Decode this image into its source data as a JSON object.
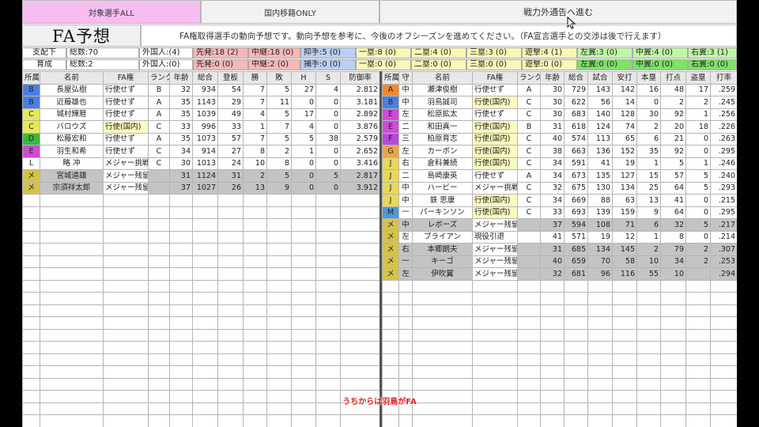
{
  "buttons": {
    "all": "対象選手ALL",
    "domestic": "国内移籍ONLY",
    "next": "戦力外通告へ進む"
  },
  "title": "FA予想",
  "description": "FA権取得選手の動向予想です。動向予想を参考に、今後のオフシーズンを進めてください。（FA宣言選手との交渉は後で行えます）",
  "summary": [
    [
      {
        "text": "支配下",
        "color": "#ffffff"
      },
      {
        "text": "総数:70",
        "color": "#ffffff"
      },
      {
        "text": "外国人:(4)",
        "color": "#ffffff"
      },
      {
        "text": "先発:18 (2)",
        "color": "#f6b8b8"
      },
      {
        "text": "中継:18 (0)",
        "color": "#f6b8b8"
      },
      {
        "text": "抑手:5 (0)",
        "color": "#b8d0f6"
      },
      {
        "text": "一塁:8 (0)",
        "color": "#fbf7b8"
      },
      {
        "text": "二塁:4 (0)",
        "color": "#fbf7b8"
      },
      {
        "text": "三塁:3 (0)",
        "color": "#fbf7b8"
      },
      {
        "text": "遊撃:4 (1)",
        "color": "#fbf7b8"
      },
      {
        "text": "左翼:3 (0)",
        "color": "#c2f5a8"
      },
      {
        "text": "中翼:4 (0)",
        "color": "#c2f5a8"
      },
      {
        "text": "右翼:3 (1)",
        "color": "#c2f5a8"
      }
    ],
    [
      {
        "text": "育成",
        "color": "#ffffff"
      },
      {
        "text": "総数:2",
        "color": "#ffffff"
      },
      {
        "text": "外国人:(0)",
        "color": "#ffffff"
      },
      {
        "text": "先発:0 (0)",
        "color": "#f6b8b8"
      },
      {
        "text": "中継:2 (0)",
        "color": "#f6b8b8"
      },
      {
        "text": "捕手:0 (0)",
        "color": "#b8d0f6"
      },
      {
        "text": "一塁:0 (0)",
        "color": "#fbf7b8"
      },
      {
        "text": "二塁:0 (0)",
        "color": "#fbf7b8"
      },
      {
        "text": "三塁:0 (0)",
        "color": "#fbf7b8"
      },
      {
        "text": "遊撃:0 (0)",
        "color": "#fbf7b8"
      },
      {
        "text": "左翼:0 (0)",
        "color": "#7fe06a"
      },
      {
        "text": "中翼:0 (0)",
        "color": "#7fe06a"
      },
      {
        "text": "右翼:0 (0)",
        "color": "#7fe06a"
      }
    ]
  ],
  "pitchers": {
    "headers": [
      "所属",
      "名前",
      "FA権",
      "ランク",
      "年齢",
      "総合",
      "登板",
      "勝",
      "敗",
      "H",
      "S",
      "防御率"
    ],
    "rows": [
      {
        "team": "B",
        "team_color": "#4a7fe0",
        "name": "長屋弘樹",
        "fa": "行使せず",
        "fa_type": "stay",
        "rank": "B",
        "age": "32",
        "ovr": "934",
        "g": "54",
        "w": "7",
        "l": "5",
        "h": "27",
        "s": "4",
        "era": "2.812",
        "gray": false
      },
      {
        "team": "B",
        "team_color": "#4a7fe0",
        "name": "近藤雄也",
        "fa": "行使せず",
        "fa_type": "stay",
        "rank": "A",
        "age": "35",
        "ovr": "1143",
        "g": "29",
        "w": "7",
        "l": "11",
        "h": "0",
        "s": "0",
        "era": "3.181",
        "gray": false
      },
      {
        "team": "C",
        "team_color": "#e8e85a",
        "name": "城村輝暦",
        "fa": "行使せず",
        "fa_type": "stay",
        "rank": "A",
        "age": "35",
        "ovr": "1039",
        "g": "49",
        "w": "4",
        "l": "5",
        "h": "17",
        "s": "0",
        "era": "2.892",
        "gray": false
      },
      {
        "team": "C",
        "team_color": "#e8e85a",
        "name": "バロウズ",
        "fa": "行使(国内)",
        "fa_type": "dom",
        "rank": "C",
        "age": "33",
        "ovr": "996",
        "g": "33",
        "w": "1",
        "l": "7",
        "h": "4",
        "s": "0",
        "era": "3.876",
        "gray": false
      },
      {
        "team": "D",
        "team_color": "#3cb83c",
        "name": "松藤宏和",
        "fa": "行使せず",
        "fa_type": "stay",
        "rank": "A",
        "age": "35",
        "ovr": "1073",
        "g": "57",
        "w": "7",
        "l": "5",
        "h": "5",
        "s": "38",
        "era": "2.579",
        "gray": false
      },
      {
        "team": "E",
        "team_color": "#d04ad8",
        "name": "羽生和希",
        "fa": "行使せず",
        "fa_type": "stay",
        "rank": "C",
        "age": "34",
        "ovr": "914",
        "g": "27",
        "w": "8",
        "l": "2",
        "h": "1",
        "s": "0",
        "era": "2.652",
        "gray": false
      },
      {
        "team": "L",
        "team_color": "#ffffff",
        "name": "略 冲",
        "fa": "メジャー挑戦",
        "fa_type": "mlb",
        "rank": "C",
        "age": "30",
        "ovr": "1013",
        "g": "24",
        "w": "10",
        "l": "8",
        "h": "0",
        "s": "0",
        "era": "3.416",
        "gray": false
      },
      {
        "team": "メ",
        "team_color": "#d6c24a",
        "name": "宮城道雄",
        "fa": "メジャー残留",
        "fa_type": "stay",
        "rank": "",
        "age": "31",
        "ovr": "1124",
        "g": "31",
        "w": "2",
        "l": "5",
        "h": "0",
        "s": "5",
        "era": "2.817",
        "gray": true
      },
      {
        "team": "メ",
        "team_color": "#d6c24a",
        "name": "宗須祥太郎",
        "fa": "メジャー残留",
        "fa_type": "stay",
        "rank": "",
        "age": "37",
        "ovr": "1027",
        "g": "26",
        "w": "13",
        "l": "9",
        "h": "0",
        "s": "0",
        "era": "3.912",
        "gray": true
      }
    ]
  },
  "batters": {
    "headers": [
      "所属",
      "守",
      "名前",
      "FA権",
      "ランク",
      "年齢",
      "総合",
      "試合",
      "安打",
      "本塁",
      "打点",
      "盗塁",
      "打率"
    ],
    "rows": [
      {
        "team": "A",
        "team_color": "#f08a2a",
        "pos": "中",
        "name": "瀬津俊樹",
        "fa": "行使せず",
        "fa_type": "stay",
        "rank": "A",
        "age": "30",
        "ovr": "729",
        "g": "143",
        "hits": "142",
        "hr": "16",
        "rbi": "48",
        "sb": "17",
        "avg": ".259",
        "gray": false
      },
      {
        "team": "B",
        "team_color": "#4a7fe0",
        "pos": "中",
        "name": "羽鳥誠司",
        "fa": "行使(国内)",
        "fa_type": "dom",
        "rank": "C",
        "age": "30",
        "ovr": "622",
        "g": "56",
        "hits": "14",
        "hr": "0",
        "rbi": "2",
        "sb": "2",
        "avg": ".245",
        "gray": false
      },
      {
        "team": "E",
        "team_color": "#d04ad8",
        "pos": "左",
        "name": "松原拡太",
        "fa": "行使せず",
        "fa_type": "stay",
        "rank": "C",
        "age": "30",
        "ovr": "683",
        "g": "140",
        "hits": "128",
        "hr": "30",
        "rbi": "92",
        "sb": "1",
        "avg": ".256",
        "gray": false
      },
      {
        "team": "E",
        "team_color": "#d04ad8",
        "pos": "二",
        "name": "和田真一",
        "fa": "行使(国内)",
        "fa_type": "dom",
        "rank": "B",
        "age": "31",
        "ovr": "618",
        "g": "124",
        "hits": "74",
        "hr": "2",
        "rbi": "20",
        "sb": "18",
        "avg": ".226",
        "gray": false
      },
      {
        "team": "F",
        "team_color": "#b64ad8",
        "pos": "三",
        "name": "柏原育志",
        "fa": "行使(国内)",
        "fa_type": "dom",
        "rank": "C",
        "age": "40",
        "ovr": "574",
        "g": "113",
        "hits": "65",
        "hr": "6",
        "rbi": "21",
        "sb": "0",
        "avg": ".263",
        "gray": false
      },
      {
        "team": "G",
        "team_color": "#e8a64a",
        "pos": "左",
        "name": "カーボン",
        "fa": "行使(国内)",
        "fa_type": "dom",
        "rank": "C",
        "age": "38",
        "ovr": "663",
        "g": "136",
        "hits": "152",
        "hr": "35",
        "rbi": "92",
        "sb": "0",
        "avg": ".295",
        "gray": false
      },
      {
        "team": "J",
        "team_color": "#e8d85a",
        "pos": "右",
        "name": "倉料兼続",
        "fa": "行使(国内)",
        "fa_type": "dom",
        "rank": "C",
        "age": "34",
        "ovr": "591",
        "g": "41",
        "hits": "19",
        "hr": "1",
        "rbi": "5",
        "sb": "1",
        "avg": ".246",
        "gray": false
      },
      {
        "team": "J",
        "team_color": "#e8d85a",
        "pos": "二",
        "name": "島崎康英",
        "fa": "行使せず",
        "fa_type": "stay",
        "rank": "A",
        "age": "34",
        "ovr": "673",
        "g": "135",
        "hits": "127",
        "hr": "15",
        "rbi": "57",
        "sb": "5",
        "avg": ".240",
        "gray": false
      },
      {
        "team": "J",
        "team_color": "#e8d85a",
        "pos": "中",
        "name": "ハービー",
        "fa": "メジャー挑戦",
        "fa_type": "mlb",
        "rank": "C",
        "age": "32",
        "ovr": "675",
        "g": "130",
        "hits": "134",
        "hr": "25",
        "rbi": "64",
        "sb": "5",
        "avg": ".293",
        "gray": false
      },
      {
        "team": "J",
        "team_color": "#e8d85a",
        "pos": "中",
        "name": "鉄 思康",
        "fa": "行使(国内)",
        "fa_type": "dom",
        "rank": "C",
        "age": "34",
        "ovr": "669",
        "g": "88",
        "hits": "63",
        "hr": "13",
        "rbi": "41",
        "sb": "0",
        "avg": ".215",
        "gray": false
      },
      {
        "team": "M",
        "team_color": "#4a9ad8",
        "pos": "一",
        "name": "パーキンソン",
        "fa": "行使(国内)",
        "fa_type": "dom",
        "rank": "C",
        "age": "33",
        "ovr": "693",
        "g": "139",
        "hits": "159",
        "hr": "9",
        "rbi": "64",
        "sb": "0",
        "avg": ".295",
        "gray": false
      },
      {
        "team": "メ",
        "team_color": "#d6c24a",
        "pos": "中",
        "name": "レボーズ",
        "fa": "メジャー残留",
        "fa_type": "stay",
        "rank": "",
        "age": "37",
        "ovr": "594",
        "g": "108",
        "hits": "71",
        "hr": "6",
        "rbi": "32",
        "sb": "5",
        "avg": ".217",
        "gray": true
      },
      {
        "team": "メ",
        "team_color": "#d6c24a",
        "pos": "左",
        "name": "ブライアン",
        "fa": "現役引退",
        "fa_type": "stay",
        "rank": "",
        "age": "41",
        "ovr": "571",
        "g": "19",
        "hits": "12",
        "hr": "1",
        "rbi": "8",
        "sb": "0",
        "avg": ".214",
        "gray": false
      },
      {
        "team": "メ",
        "team_color": "#d6c24a",
        "pos": "右",
        "name": "本郷朗夫",
        "fa": "メジャー残留",
        "fa_type": "stay",
        "rank": "",
        "age": "31",
        "ovr": "685",
        "g": "134",
        "hits": "145",
        "hr": "2",
        "rbi": "79",
        "sb": "2",
        "avg": ".307",
        "gray": true
      },
      {
        "team": "メ",
        "team_color": "#d6c24a",
        "pos": "一",
        "name": "キーゴ",
        "fa": "メジャー残留",
        "fa_type": "stay",
        "rank": "",
        "age": "40",
        "ovr": "659",
        "g": "70",
        "hits": "58",
        "hr": "10",
        "rbi": "34",
        "sb": "2",
        "avg": ".253",
        "gray": true
      },
      {
        "team": "メ",
        "team_color": "#d6c24a",
        "pos": "左",
        "name": "伊吹翼",
        "fa": "メジャー残留",
        "fa_type": "stay",
        "rank": "",
        "age": "32",
        "ovr": "681",
        "g": "96",
        "hits": "116",
        "hr": "55",
        "rbi": "10",
        "sb": "",
        "avg": ".294",
        "gray": true
      }
    ]
  },
  "subtitle": "うちからは羽鳥がFA"
}
